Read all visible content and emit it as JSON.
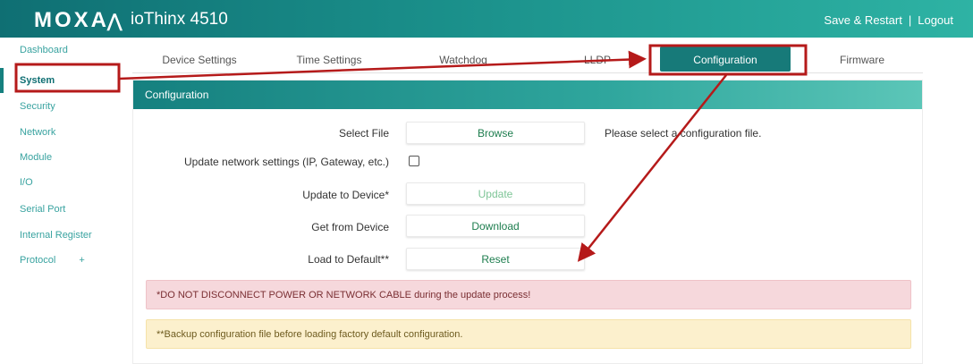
{
  "header": {
    "logo_text": "MOXA",
    "logo_mark": "⋀",
    "product": "ioThinx 4510",
    "save_restart": "Save & Restart",
    "separator": "|",
    "logout": "Logout"
  },
  "sidebar": {
    "items": [
      {
        "label": "Dashboard"
      },
      {
        "label": "System"
      },
      {
        "label": "Security"
      },
      {
        "label": "Network"
      },
      {
        "label": "Module"
      },
      {
        "label": "I/O"
      },
      {
        "label": "Serial Port"
      },
      {
        "label": "Internal Register"
      },
      {
        "label": "Protocol",
        "suffix": "+"
      }
    ]
  },
  "tabs": [
    {
      "label": "Device Settings"
    },
    {
      "label": "Time Settings"
    },
    {
      "label": "Watchdog"
    },
    {
      "label": "LLDP"
    },
    {
      "label": "Configuration"
    },
    {
      "label": "Firmware"
    }
  ],
  "panel": {
    "title": "Configuration",
    "select_file": {
      "label": "Select File",
      "button": "Browse",
      "hint": "Please select a configuration file."
    },
    "update_network": {
      "label": "Update network settings (IP, Gateway, etc.)",
      "checked": false
    },
    "update_device": {
      "label": "Update to Device*",
      "button": "Update"
    },
    "get_device": {
      "label": "Get from Device",
      "button": "Download"
    },
    "load_default": {
      "label": "Load to Default**",
      "button": "Reset"
    },
    "alert_danger": "*DO NOT DISCONNECT POWER OR NETWORK CABLE during the update process!",
    "alert_warning": "**Backup configuration file before loading factory default configuration."
  },
  "colors": {
    "accent": "#15807f",
    "annotation": "#b51a1a"
  }
}
